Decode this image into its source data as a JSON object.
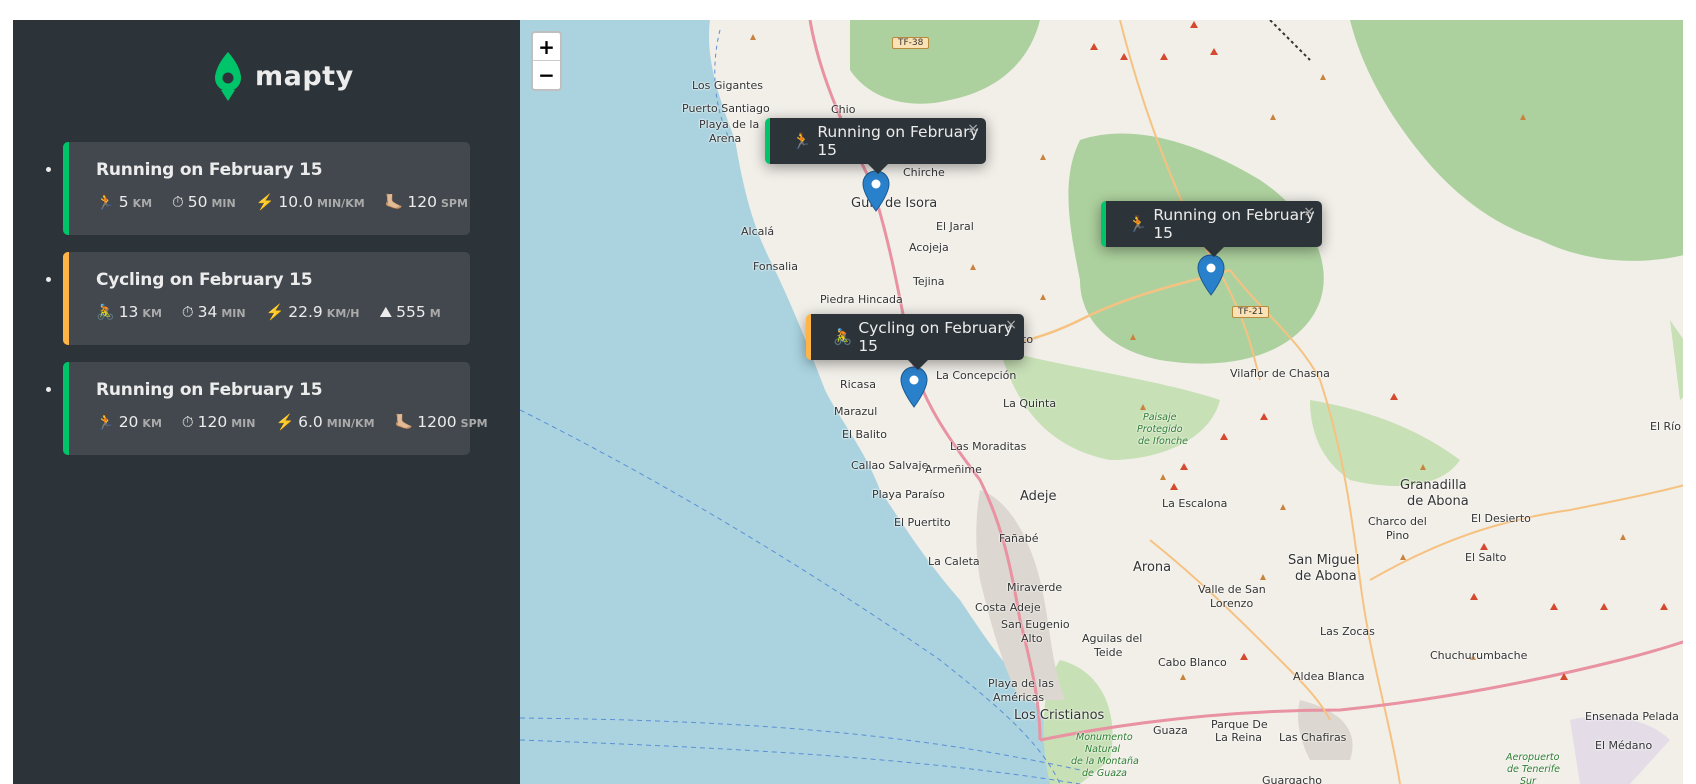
{
  "app": {
    "name": "mapty"
  },
  "workouts": [
    {
      "type": "running",
      "title": "Running on February 15",
      "details": [
        {
          "icon": "🏃",
          "value": "5",
          "unit": "km"
        },
        {
          "icon": "⏱",
          "value": "50",
          "unit": "min"
        },
        {
          "icon": "⚡️",
          "value": "10.0",
          "unit": "min/km"
        },
        {
          "icon": "🦶🏼",
          "value": "120",
          "unit": "spm"
        }
      ]
    },
    {
      "type": "cycling",
      "title": "Cycling on February 15",
      "details": [
        {
          "icon": "🚴",
          "value": "13",
          "unit": "km"
        },
        {
          "icon": "⏱",
          "value": "34",
          "unit": "min"
        },
        {
          "icon": "⚡️",
          "value": "22.9",
          "unit": "km/h"
        },
        {
          "icon": "⛰",
          "value": "555",
          "unit": "m"
        }
      ]
    },
    {
      "type": "running",
      "title": "Running on February 15",
      "details": [
        {
          "icon": "🏃",
          "value": "20",
          "unit": "km"
        },
        {
          "icon": "⏱",
          "value": "120",
          "unit": "min"
        },
        {
          "icon": "⚡️",
          "value": "6.0",
          "unit": "min/km"
        },
        {
          "icon": "🦶🏼",
          "value": "1200",
          "unit": "spm"
        }
      ]
    }
  ],
  "map": {
    "zoom_in": "+",
    "zoom_out": "−",
    "popups": [
      {
        "type": "running",
        "icon": "🏃",
        "label": "Running on February 15",
        "close": "×"
      },
      {
        "type": "running",
        "icon": "🏃",
        "label": "Running on February 15",
        "close": "×"
      },
      {
        "type": "cycling",
        "icon": "🚴",
        "label": "Cycling on February 15",
        "close": "×"
      }
    ],
    "places": {
      "los_gigantes": "Los Gigantes",
      "puerto_santiago": "Puerto Santiago",
      "playa_de_la": "Playa de la",
      "arena": "Arena",
      "chio": "Chio",
      "chirche": "Chirche",
      "guia_de_isora": "Guía de Isora",
      "el_jaral": "El Jaral",
      "alcala": "Alcalá",
      "acojeja": "Acojeja",
      "fonsalia": "Fonsalia",
      "tejina": "Tejina",
      "piedra_hincada": "Piedra Hincada",
      "la_concepcion": "La Concepción",
      "ricasa": "Ricasa",
      "la_quinta": "La Quinta",
      "marazul": "Marazul",
      "el_balito": "El Balito",
      "las_moraditas": "Las Moraditas",
      "callao_salvaje": "Callao Salvaje",
      "armenime": "Armeñime",
      "playa_paraiso": "Playa Paraíso",
      "adeje": "Adeje",
      "el_puertito": "El Puertito",
      "fanabe": "Fañabé",
      "la_caleta": "La Caleta",
      "miraverde": "Miraverde",
      "costa_adeje": "Costa Adeje",
      "san_eugenio": "San Eugenio",
      "alto": "Alto",
      "playa_de_las": "Playa de las",
      "americas": "Américas",
      "los_cristianos": "Los Cristianos",
      "vilaflor": "Vilaflor de Chasna",
      "la_escalona": "La Escalona",
      "arona": "Arona",
      "valle_san_lorenzo_1": "Valle de San",
      "valle_san_lorenzo_2": "Lorenzo",
      "san_miguel_1": "San Miguel",
      "san_miguel_2": "de Abona",
      "granadilla_1": "Granadilla",
      "granadilla_2": "de Abona",
      "charco_del_1": "Charco del",
      "charco_del_2": "Pino",
      "el_desierto": "El Desierto",
      "el_salto": "El Salto",
      "las_zocas": "Las Zocas",
      "chuchurumbache": "Chuchurumbache",
      "aguilas_1": "Aguilas del",
      "aguilas_2": "Teide",
      "cabo_blanco": "Cabo Blanco",
      "aldea_blanca": "Aldea Blanca",
      "guaza": "Guaza",
      "parque_de_1": "Parque De",
      "parque_de_2": "La Reina",
      "las_chafiras": "Las Chafiras",
      "ensenada": "Ensenada Pelada",
      "el_medano": "El Médano",
      "el_rio": "El Río",
      "guargacho": "Guargacho",
      "paisaje_1": "Paisaje",
      "paisaje_2": "Protegido",
      "paisaje_3": "de Ifonche",
      "monumento_1": "Monumento",
      "monumento_2": "Natural",
      "monumento_3": "de la Montaña",
      "monumento_4": "de Guaza",
      "aeropuerto_1": "Aeropuerto",
      "aeropuerto_2": "de Tenerife",
      "aeropuerto_3": "Sur",
      "to": "to"
    },
    "roads": {
      "tf38": "TF-38",
      "tf21": "TF-21"
    }
  },
  "colors": {
    "running": "#00c46a",
    "cycling": "#ffb545",
    "sidebar": "#2d3439",
    "card": "#42484d",
    "sea": "#aad3df"
  }
}
